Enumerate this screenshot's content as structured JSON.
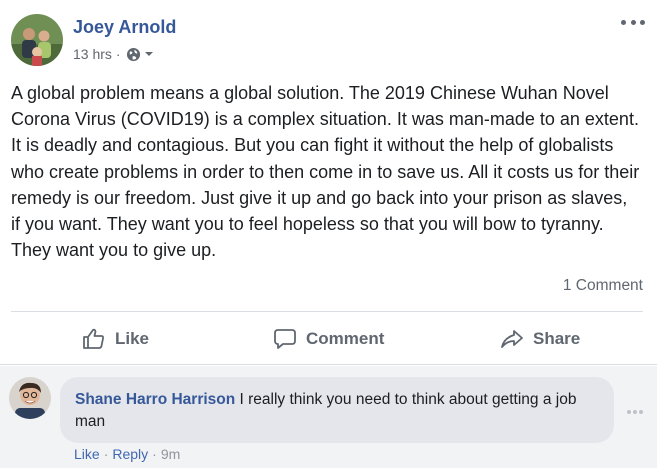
{
  "post": {
    "author": "Joey Arnold",
    "timestamp": "13 hrs",
    "separator": "·",
    "privacy_icon": "globe-icon",
    "more_icon": "more-horizontal-icon",
    "text": "A global problem means a global solution. The 2019 Chinese Wuhan Novel Corona Virus (COVID19) is a complex situation. It was man-made to an extent. It is deadly and contagious. But you can fight it without the help of globalists who create problems in order to then come in to save us. All it costs us for their remedy is our freedom. Just give it up and go back into your prison as slaves, if you want. They want you to feel hopeless so that you will bow to tyranny. They want you to give up.",
    "comment_count": "1 Comment"
  },
  "actions": {
    "like_label": "Like",
    "comment_label": "Comment",
    "share_label": "Share"
  },
  "comment": {
    "author": "Shane Harro Harrison",
    "text": "I really think you need to think about getting a job man",
    "like_label": "Like",
    "dot": "·",
    "reply_label": "Reply",
    "time": "9m"
  },
  "colors": {
    "link_blue": "#365899",
    "action_gray": "#606770",
    "bubble_bg": "#e4e6eb",
    "comment_area_bg": "#f2f3f5"
  }
}
